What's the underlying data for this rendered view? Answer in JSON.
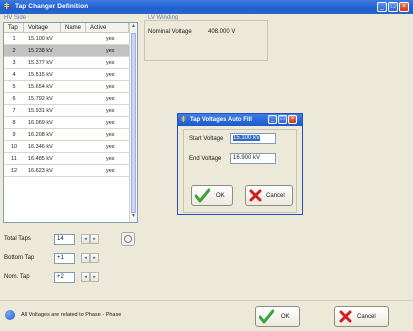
{
  "window": {
    "title": "Tap Changer Definition",
    "buttons": [
      "_",
      "□",
      "×"
    ]
  },
  "hv_side": {
    "label": "HV Side",
    "columns": [
      "Tap",
      "Voltage",
      "Name",
      "Active"
    ],
    "rows": [
      {
        "tap": "1",
        "voltage": "15.100 kV",
        "name": "",
        "active": "yes"
      },
      {
        "tap": "2",
        "voltage": "15.238 kV",
        "name": "",
        "active": "yes"
      },
      {
        "tap": "3",
        "voltage": "15.377 kV",
        "name": "",
        "active": "yes"
      },
      {
        "tap": "4",
        "voltage": "15.515 kV",
        "name": "",
        "active": "yes"
      },
      {
        "tap": "5",
        "voltage": "15.654 kV",
        "name": "",
        "active": "yes"
      },
      {
        "tap": "6",
        "voltage": "15.792 kV",
        "name": "",
        "active": "yes"
      },
      {
        "tap": "7",
        "voltage": "15.931 kV",
        "name": "",
        "active": "yes"
      },
      {
        "tap": "8",
        "voltage": "16.069 kV",
        "name": "",
        "active": "yes"
      },
      {
        "tap": "9",
        "voltage": "16.208 kV",
        "name": "",
        "active": "yes"
      },
      {
        "tap": "10",
        "voltage": "16.346 kV",
        "name": "",
        "active": "yes"
      },
      {
        "tap": "11",
        "voltage": "16.485 kV",
        "name": "",
        "active": "yes"
      },
      {
        "tap": "12",
        "voltage": "16.623 kV",
        "name": "",
        "active": "yes"
      }
    ],
    "selected_tap": "2"
  },
  "lv_winding": {
    "label": "LV Winding",
    "nominal_label": "Nominal Voltage",
    "nominal_value": "408.000 V"
  },
  "settings": {
    "total_taps_label": "Total Taps",
    "total_taps": "14",
    "bottom_tap_label": "Bottom Tap",
    "bottom_tap": "+1",
    "nom_tap_label": "Nom. Tap",
    "nom_tap": "+2"
  },
  "dialog": {
    "title": "Tap Voltages Auto Fill",
    "start_label": "Start Voltage",
    "start_value": "15.100 kV",
    "end_label": "End Voltage",
    "end_value": "16.900 kV",
    "ok": "OK",
    "cancel": "Cancel"
  },
  "status": {
    "message": "All Voltages are related to Phase - Phase",
    "ok": "OK",
    "cancel": "Cancel"
  },
  "colors": {
    "title_blue": "#1f5fd0",
    "ok_green": "#3aa33a",
    "cancel_red": "#d02020",
    "selection": "#c2c2c2"
  }
}
